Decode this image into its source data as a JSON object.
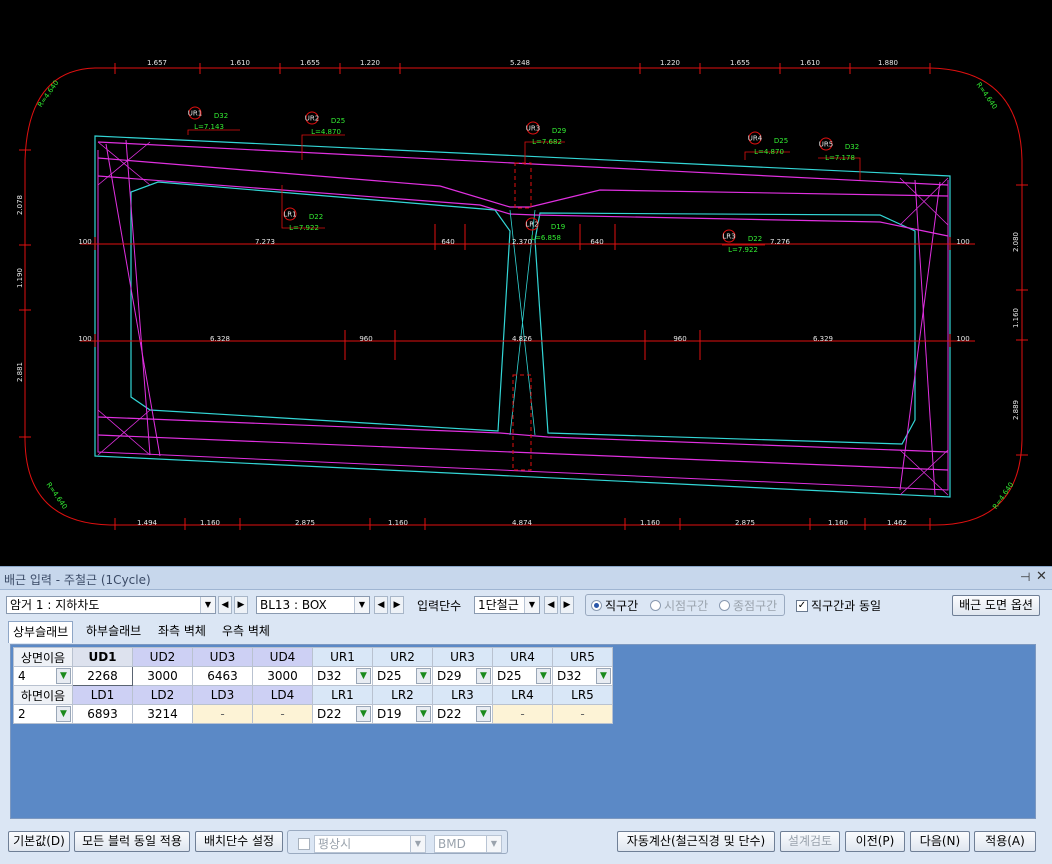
{
  "drawing": {
    "top_dims": [
      "1.657",
      "1.610",
      "1.655",
      "1.220",
      "5.248",
      "1.220",
      "1.655",
      "1.610",
      "1.880"
    ],
    "bottom_dims": [
      "1.494",
      "1.160",
      "2.875",
      "1.160",
      "4.874",
      "1.160",
      "2.875",
      "1.160",
      "1.462"
    ],
    "left_dims": [
      "2.078",
      "1.190",
      "2.881"
    ],
    "right_dims": [
      "2.080",
      "1.160",
      "2.889"
    ],
    "corner_labels": [
      "R=4.640",
      "R=4.640",
      "R=4.640",
      "R=4.640"
    ],
    "row1_dims": [
      "100",
      "7.273",
      "640",
      "2.370",
      "640",
      "7.276",
      "100"
    ],
    "row2_dims": [
      "100",
      "6.328",
      "960",
      "4.826",
      "960",
      "6.329",
      "100"
    ],
    "rebar_tags": [
      {
        "tag": "UR1",
        "dia": "D32",
        "len": "L=7.143"
      },
      {
        "tag": "UR2",
        "dia": "D25",
        "len": "L=4.870"
      },
      {
        "tag": "UR3",
        "dia": "D29",
        "len": "L=7.682"
      },
      {
        "tag": "UR4",
        "dia": "D25",
        "len": "L=4.870"
      },
      {
        "tag": "UR5",
        "dia": "D32",
        "len": "L=7.178"
      },
      {
        "tag": "LR1",
        "dia": "D22",
        "len": "L=7.922"
      },
      {
        "tag": "LR2",
        "dia": "D19",
        "len": "L=6.858"
      },
      {
        "tag": "LR3",
        "dia": "D22",
        "len": "L=7.922"
      }
    ]
  },
  "panel": {
    "title": "배근 입력 - 주철근 (1Cycle)",
    "pin_icon": "⊣",
    "close_icon": "✕",
    "section_combo": "암거 1 : 지하차도",
    "block_combo": "BL13 : BOX",
    "input_level_label": "입력단수",
    "input_level_value": "1단철근",
    "radio_straight": "직구간",
    "radio_start": "시점구간",
    "radio_end": "종점구간",
    "same_as_straight": "직구간과 동일",
    "drawing_options_button": "배근 도면 옵션",
    "tabs": [
      "상부슬래브",
      "하부슬래브",
      "좌측 벽체",
      "우측 벽체"
    ],
    "top_row_label": "상면이음",
    "bottom_row_label": "하면이음",
    "top_count": "4",
    "bottom_count": "2",
    "top_headers": [
      "UD1",
      "UD2",
      "UD3",
      "UD4",
      "UR1",
      "UR2",
      "UR3",
      "UR4",
      "UR5"
    ],
    "top_values": [
      "2268",
      "3000",
      "6463",
      "3000",
      "D32",
      "D25",
      "D29",
      "D25",
      "D32"
    ],
    "bottom_headers": [
      "LD1",
      "LD2",
      "LD3",
      "LD4",
      "LR1",
      "LR2",
      "LR3",
      "LR4",
      "LR5"
    ],
    "bottom_values": [
      "6893",
      "3214",
      "-",
      "-",
      "D22",
      "D19",
      "D22",
      "-",
      "-"
    ],
    "btn_default": "기본값(D)",
    "btn_apply_all": "모든 블럭 동일 적용",
    "btn_layout_level": "배치단수 설정",
    "normal_label": "평상시",
    "bmd_label": "BMD",
    "btn_auto_calc": "자동계산(철근직경 및 단수)",
    "btn_design_check": "설계검토",
    "btn_prev": "이전(P)",
    "btn_next": "다음(N)",
    "btn_apply": "적용(A)"
  }
}
